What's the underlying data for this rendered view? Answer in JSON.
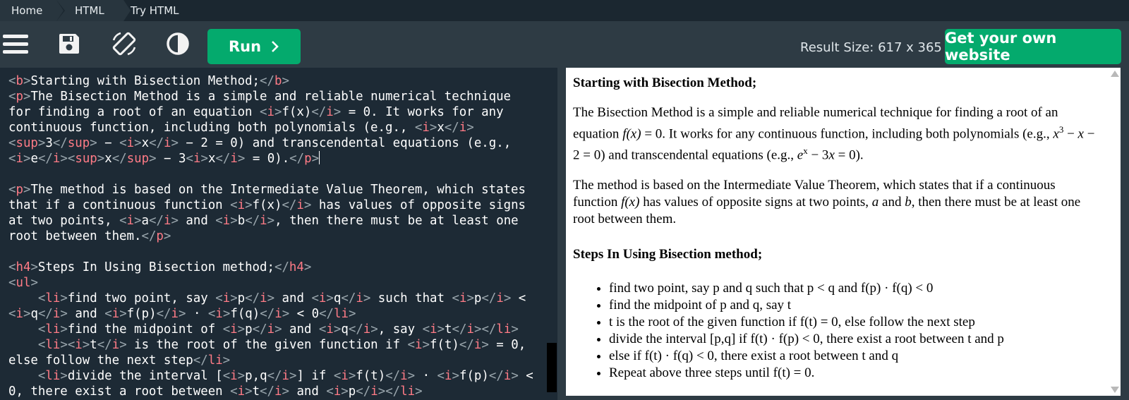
{
  "breadcrumb": {
    "items": [
      "Home",
      "HTML",
      "Try HTML"
    ]
  },
  "toolbar": {
    "menu_icon": "hamburger-icon",
    "save_icon": "floppy-disk-icon",
    "rotate_icon": "rotate-screen-icon",
    "theme_icon": "contrast-icon",
    "run_label": "Run",
    "run_icon": "chevron-right-icon",
    "result_size": "Result Size: 617 x 365",
    "own_website_label": "Get your own website"
  },
  "editor": {
    "lines": [
      "<b>Starting with Bisection Method;</b>",
      "<p>The Bisection Method is a simple and reliable numerical technique",
      "for finding a root of an equation <i>f(x)</i> = 0. It works for any",
      "continuous function, including both polynomials (e.g., <i>x</i>",
      "<sup>3</sup> − <i>x</i> − 2 = 0) and transcendental equations (e.g.,",
      "<i>e</i><sup>x</sup> − 3<i>x</i> = 0).</p>",
      "",
      "<p>The method is based on the Intermediate Value Theorem, which states",
      "that if a continuous function <i>f(x)</i> has values of opposite signs",
      "at two points, <i>a</i> and <i>b</i>, then there must be at least one",
      "root between them.</p>",
      "",
      "<h4>Steps In Using Bisection method;</h4>",
      "<ul>",
      "    <li>find two point, say <i>p</i> and <i>q</i> such that <i>p</i> <",
      "<i>q</i> and <i>f(p)</i> · <i>f(q)</i> < 0</li>",
      "    <li>find the midpoint of <i>p</i> and <i>q</i>, say <i>t</i></li>",
      "    <li><i>t</i> is the root of the given function if <i>f(t)</i> = 0,",
      "else follow the next step</li>",
      "    <li>divide the interval [<i>p,q</i>] if <i>f(t)</i> · <i>f(p)</i> <",
      "0, there exist a root between <i>t</i> and <i>p</i></li>"
    ]
  },
  "result": {
    "heading": "Starting with Bisection Method;",
    "p1_a": "The Bisection Method is a simple and reliable numerical technique for finding a root of an equation ",
    "p1_fx": "f(x)",
    "p1_b": " = 0. It works for any continuous function, including both polynomials (e.g., ",
    "p1_x1": "x",
    "p1_sup3": "3",
    "p1_c": " − ",
    "p1_x2": "x",
    "p1_d": " − 2 = 0) and transcendental equations (e.g., ",
    "p1_e": "e",
    "p1_supx": "x",
    "p1_f": " − 3",
    "p1_x3": "x",
    "p1_g": " = 0).",
    "p2_a": "The method is based on the Intermediate Value Theorem, which states that if a continuous function ",
    "p2_fx": "f(x)",
    "p2_b": " has values of opposite signs at two points, ",
    "p2_a_var": "a",
    "p2_c": " and ",
    "p2_b_var": "b",
    "p2_d": ", then there must be at least one root between them.",
    "h4": "Steps In Using Bisection method;",
    "steps": [
      "find two point, say p and q such that p < q and f(p) · f(q) < 0",
      "find the midpoint of p and q, say t",
      "t is the root of the given function if f(t) = 0, else follow the next step",
      "divide the interval [p,q] if f(t) · f(p) < 0, there exist a root between t and p",
      "else if f(t) · f(q) < 0, there exist a root between t and q",
      "Repeat above three steps until f(t) = 0."
    ]
  },
  "colors": {
    "accent": "#04aa6d",
    "editor_bg": "#1d2a35",
    "tag": "#ff7b86",
    "chrome": "#2e3b44"
  }
}
